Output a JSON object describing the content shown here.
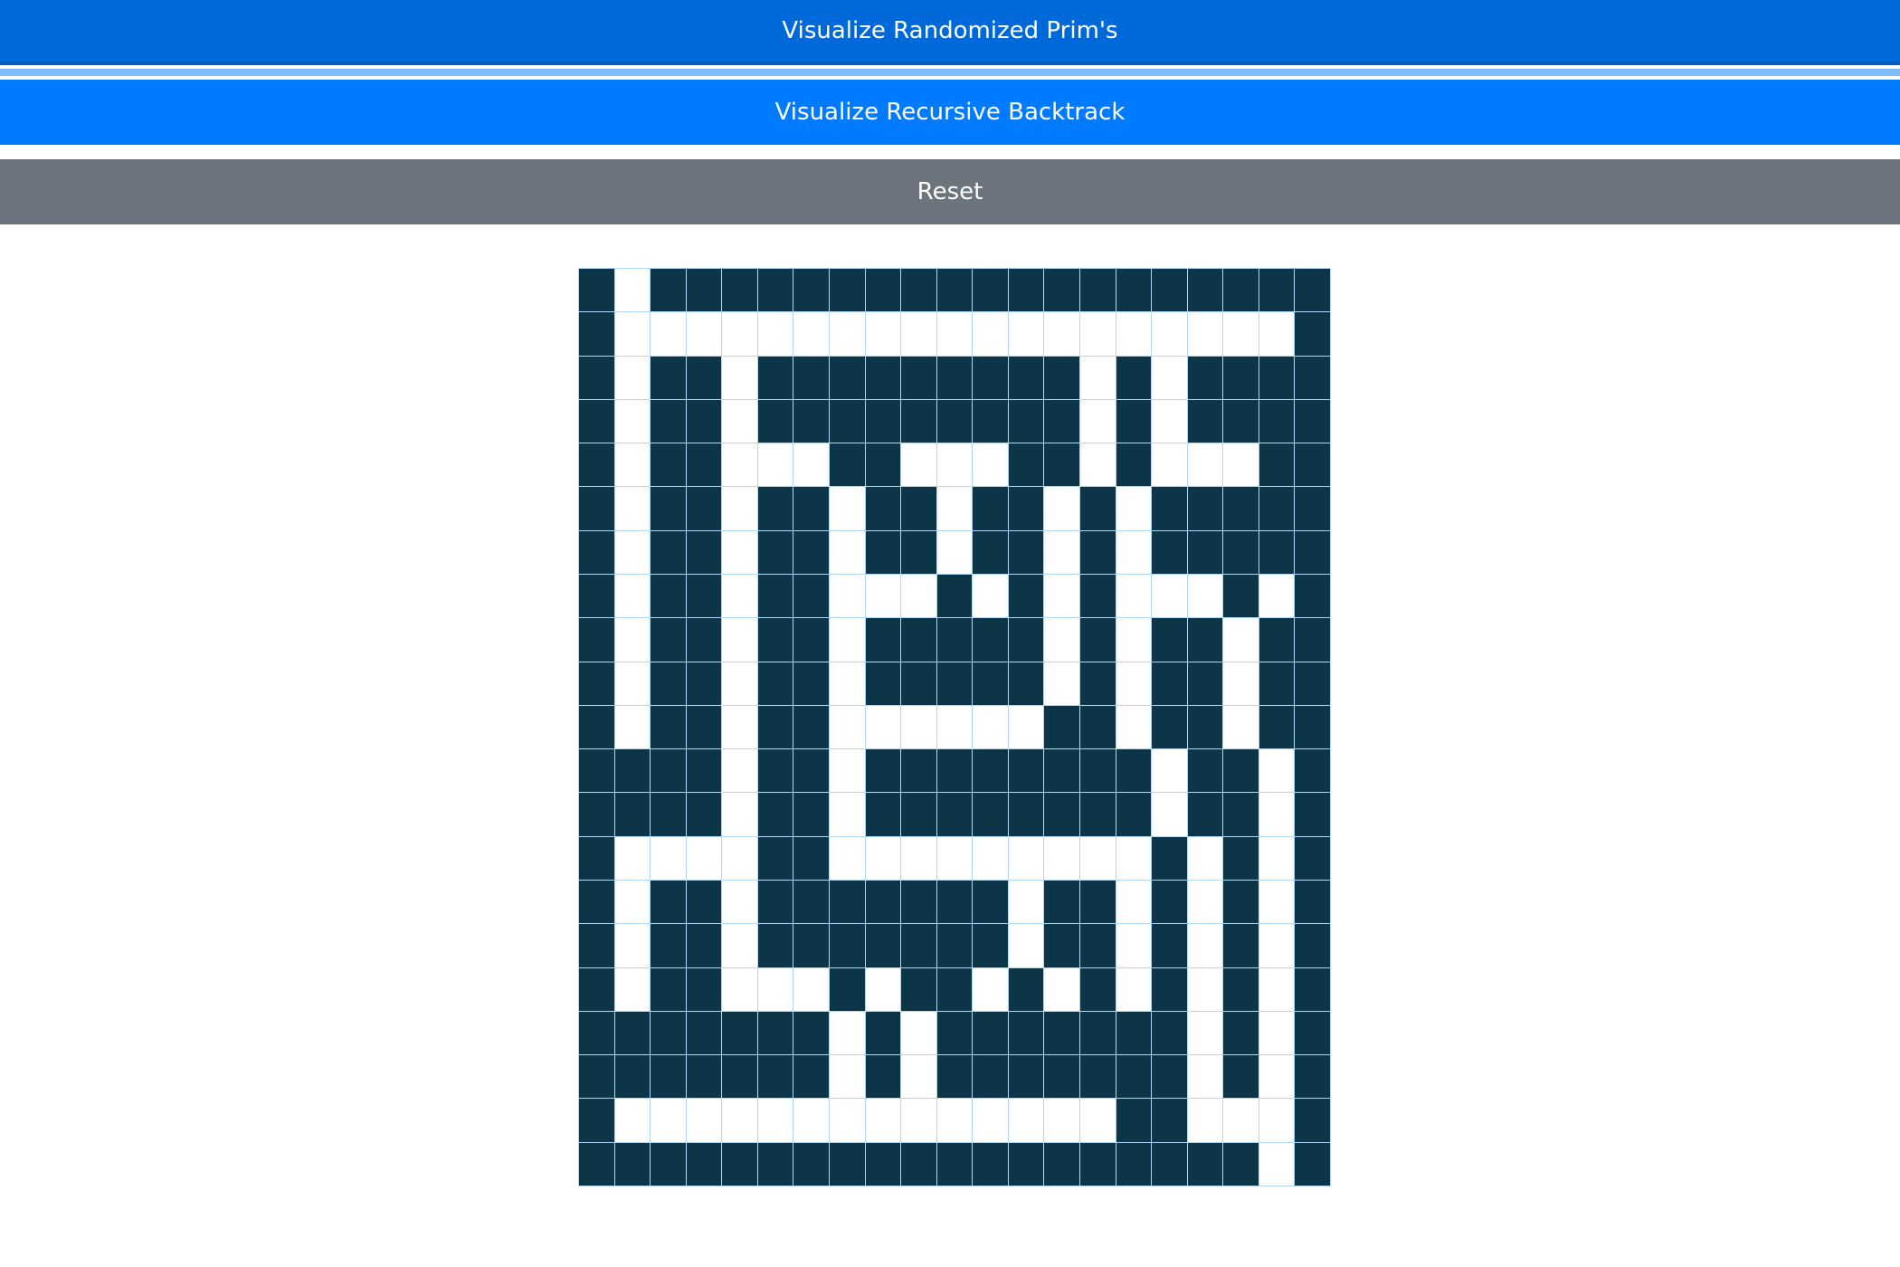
{
  "buttons": {
    "prims_label": "Visualize Randomized Prim's",
    "backtrack_label": "Visualize Recursive Backtrack",
    "reset_label": "Reset"
  },
  "colors": {
    "wall": "#0c3547",
    "path": "#ffffff",
    "grid_line": "#afd8f8",
    "prims_button": "#0069d9",
    "backtrack_button": "#007bff",
    "reset_button": "#6c757d"
  },
  "maze": {
    "rows": 21,
    "cols": 21,
    "grid": [
      "#.###################",
      "#...................#",
      "#.##.#########.#.####",
      "#.##.#########.#.####",
      "#.##...##...##.#...##",
      "#.##.##.##.##.#.#####",
      "#.##.##.##.##.#.#####",
      "#.##.##...#.#.#...#.#",
      "#.##.##.#####.#.##.##",
      "#.##.##.#####.#.##.##",
      "#.##.##......##.##.##",
      "####.##.########.##.#",
      "####.##.########.##.#",
      "#....##.........#.#.#",
      "#.##.#######.##.#.#.#",
      "#.##.#######.##.#.#.#",
      "#.##...#.##.#.#.#.#.#",
      "#######.#.#######.#.#",
      "#######.#.#######.#.#",
      "#..............##...#",
      "###################.#"
    ]
  }
}
